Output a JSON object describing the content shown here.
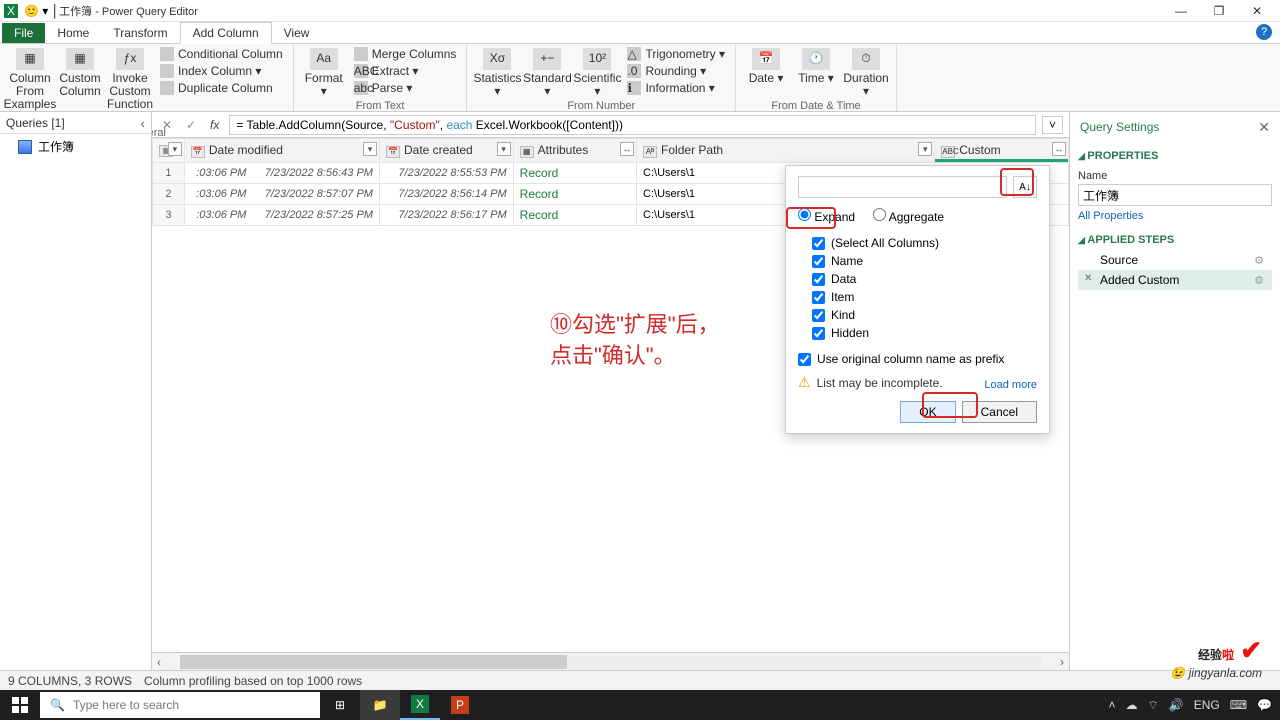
{
  "window": {
    "title": "工作簿 - Power Query Editor"
  },
  "tabs": {
    "file": "File",
    "home": "Home",
    "transform": "Transform",
    "add_column": "Add Column",
    "view": "View"
  },
  "ribbon": {
    "general": {
      "label": "General",
      "col_from_examples": "Column From Examples ▾",
      "custom_col": "Custom Column",
      "invoke_fn": "Invoke Custom Function",
      "cond_col": "Conditional Column",
      "index_col": "Index Column ▾",
      "dup_col": "Duplicate Column"
    },
    "from_text": {
      "label": "From Text",
      "format": "Format ▾",
      "merge": "Merge Columns",
      "extract": "Extract ▾",
      "parse": "Parse ▾"
    },
    "from_number": {
      "label": "From Number",
      "statistics": "Statistics ▾",
      "standard": "Standard ▾",
      "scientific": "Scientific ▾",
      "trig": "Trigonometry ▾",
      "rounding": "Rounding ▾",
      "info": "Information ▾"
    },
    "from_dt": {
      "label": "From Date & Time",
      "date": "Date ▾",
      "time": "Time ▾",
      "duration": "Duration ▾"
    }
  },
  "queries": {
    "header": "Queries [1]",
    "items": [
      "工作簿"
    ]
  },
  "formula": {
    "prefix": "= Table.AddColumn(Source, ",
    "str": "\"Custom\"",
    "mid": ", ",
    "kw": "each",
    "suffix": " Excel.Workbook([Content]))"
  },
  "columns": {
    "date_modified": "Date modified",
    "date_created": "Date created",
    "attributes": "Attributes",
    "folder_path": "Folder Path",
    "custom": "Custom"
  },
  "rows": [
    {
      "n": "1",
      "dm_t": ":03:06 PM",
      "dm": "7/23/2022 8:56:43 PM",
      "dc": "7/23/2022 8:55:53 PM",
      "attr": "Record",
      "fp": "C:\\Users\\1"
    },
    {
      "n": "2",
      "dm_t": ":03:06 PM",
      "dm": "7/23/2022 8:57:07 PM",
      "dc": "7/23/2022 8:56:14 PM",
      "attr": "Record",
      "fp": "C:\\Users\\1"
    },
    {
      "n": "3",
      "dm_t": ":03:06 PM",
      "dm": "7/23/2022 8:57:25 PM",
      "dc": "7/23/2022 8:56:17 PM",
      "attr": "Record",
      "fp": "C:\\Users\\1"
    }
  ],
  "popup": {
    "expand": "Expand",
    "aggregate": "Aggregate",
    "select_all": "(Select All Columns)",
    "cols": [
      "Name",
      "Data",
      "Item",
      "Kind",
      "Hidden"
    ],
    "prefix": "Use original column name as prefix",
    "warn": "List may be incomplete.",
    "load_more": "Load more",
    "ok": "OK",
    "cancel": "Cancel"
  },
  "settings": {
    "title": "Query Settings",
    "properties": "PROPERTIES",
    "name_label": "Name",
    "name_value": "工作簿",
    "all_props": "All Properties",
    "applied_steps": "APPLIED STEPS",
    "steps": [
      "Source",
      "Added Custom"
    ]
  },
  "status": {
    "cols": "9 COLUMNS, 3 ROWS",
    "profile": "Column profiling based on top 1000 rows"
  },
  "taskbar": {
    "search": "Type here to search"
  },
  "annotation": "⑩勾选\"扩展\"后，\n点击\"确认\"。",
  "logo": {
    "line1a": "经验",
    "line1b": "啦",
    "line2": "jingyanla.com"
  }
}
